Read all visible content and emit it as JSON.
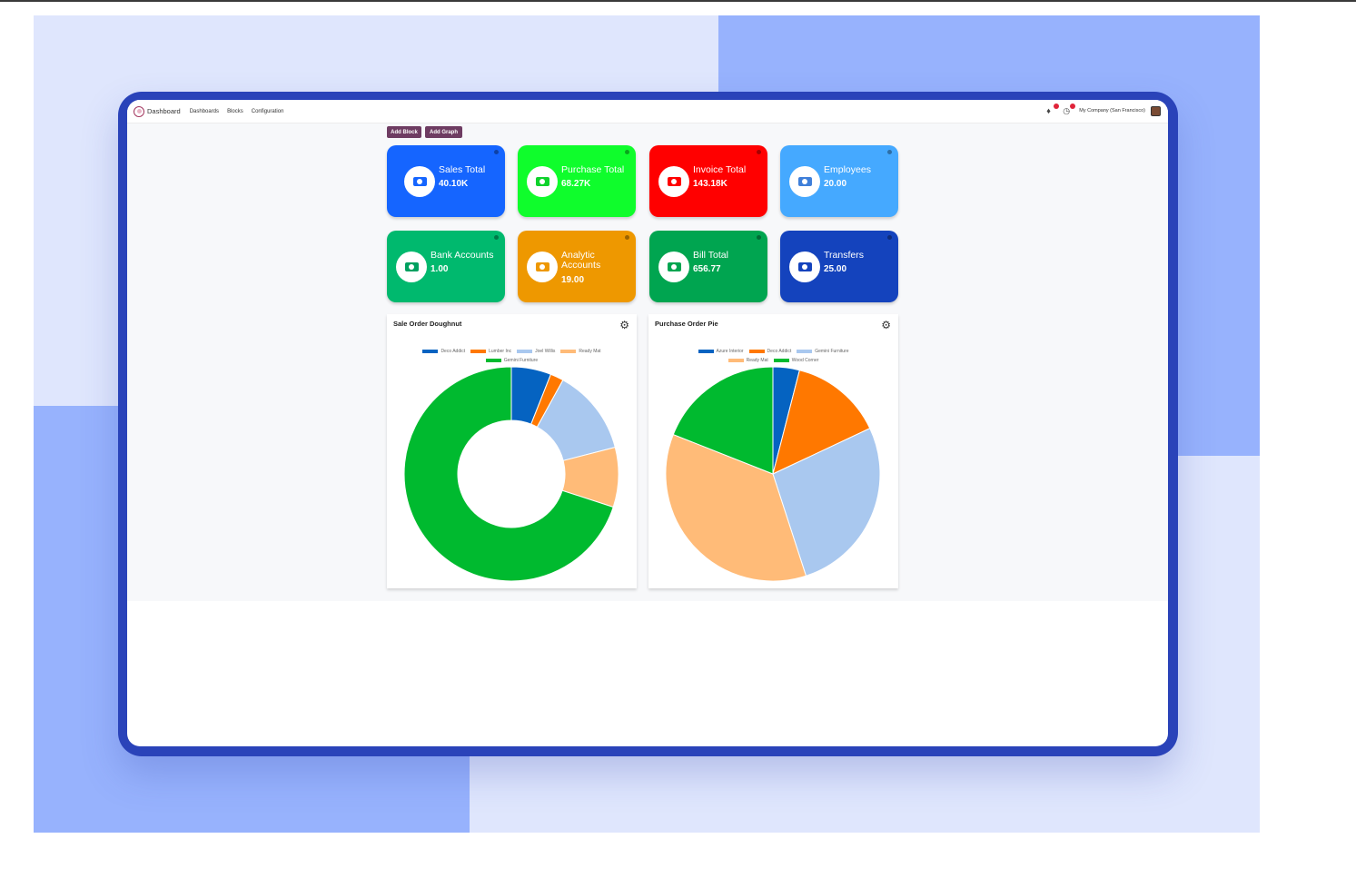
{
  "navbar": {
    "app_name": "Dashboard",
    "menu": [
      "Dashboards",
      "Blocks",
      "Configuration"
    ],
    "company": "My Company (San Francisco)"
  },
  "actions": {
    "add_block": "Add Block",
    "add_graph": "Add Graph"
  },
  "tiles": [
    {
      "title": "Sales Total",
      "value": "40.10K",
      "color": "#1565ff",
      "icon_color": "#1565ff"
    },
    {
      "title": "Purchase Total",
      "value": "68.27K",
      "color": "#0ffd2c",
      "icon_color": "#0fd22c"
    },
    {
      "title": "Invoice Total",
      "value": "143.18K",
      "color": "#ff0000",
      "icon_color": "#ff0000"
    },
    {
      "title": "Employees",
      "value": "20.00",
      "color": "#45a9ff",
      "icon_color": "#3f7fd9"
    },
    {
      "title": "Bank Accounts",
      "value": "1.00",
      "color": "#00b96e",
      "icon_color": "#00a060"
    },
    {
      "title": "Analytic Accounts",
      "value": "19.00",
      "color": "#ee9800",
      "icon_color": "#ee9800"
    },
    {
      "title": "Bill Total",
      "value": "656.77",
      "color": "#00a550",
      "icon_color": "#00a550"
    },
    {
      "title": "Transfers",
      "value": "25.00",
      "color": "#1443bd",
      "icon_color": "#1443bd"
    }
  ],
  "chart_data": [
    {
      "type": "doughnut",
      "title": "Sale Order Doughnut",
      "series": [
        {
          "name": "Deco Addict",
          "value": 6,
          "color": "#0563c1"
        },
        {
          "name": "Lumber Inc",
          "value": 2,
          "color": "#ff7800"
        },
        {
          "name": "Joel Willis",
          "value": 13,
          "color": "#a9c8ef"
        },
        {
          "name": "Ready Mat",
          "value": 9,
          "color": "#ffbb78"
        },
        {
          "name": "Gemini Furniture",
          "value": 70,
          "color": "#00ba2f"
        }
      ]
    },
    {
      "type": "pie",
      "title": "Purchase Order Pie",
      "series": [
        {
          "name": "Azure Interior",
          "value": 4,
          "color": "#0563c1"
        },
        {
          "name": "Deco Addict",
          "value": 14,
          "color": "#ff7800"
        },
        {
          "name": "Gemini Furniture",
          "value": 27,
          "color": "#a9c8ef"
        },
        {
          "name": "Ready Mat",
          "value": 36,
          "color": "#ffbb78"
        },
        {
          "name": "Wood Corner",
          "value": 19,
          "color": "#00ba2f"
        }
      ]
    }
  ]
}
